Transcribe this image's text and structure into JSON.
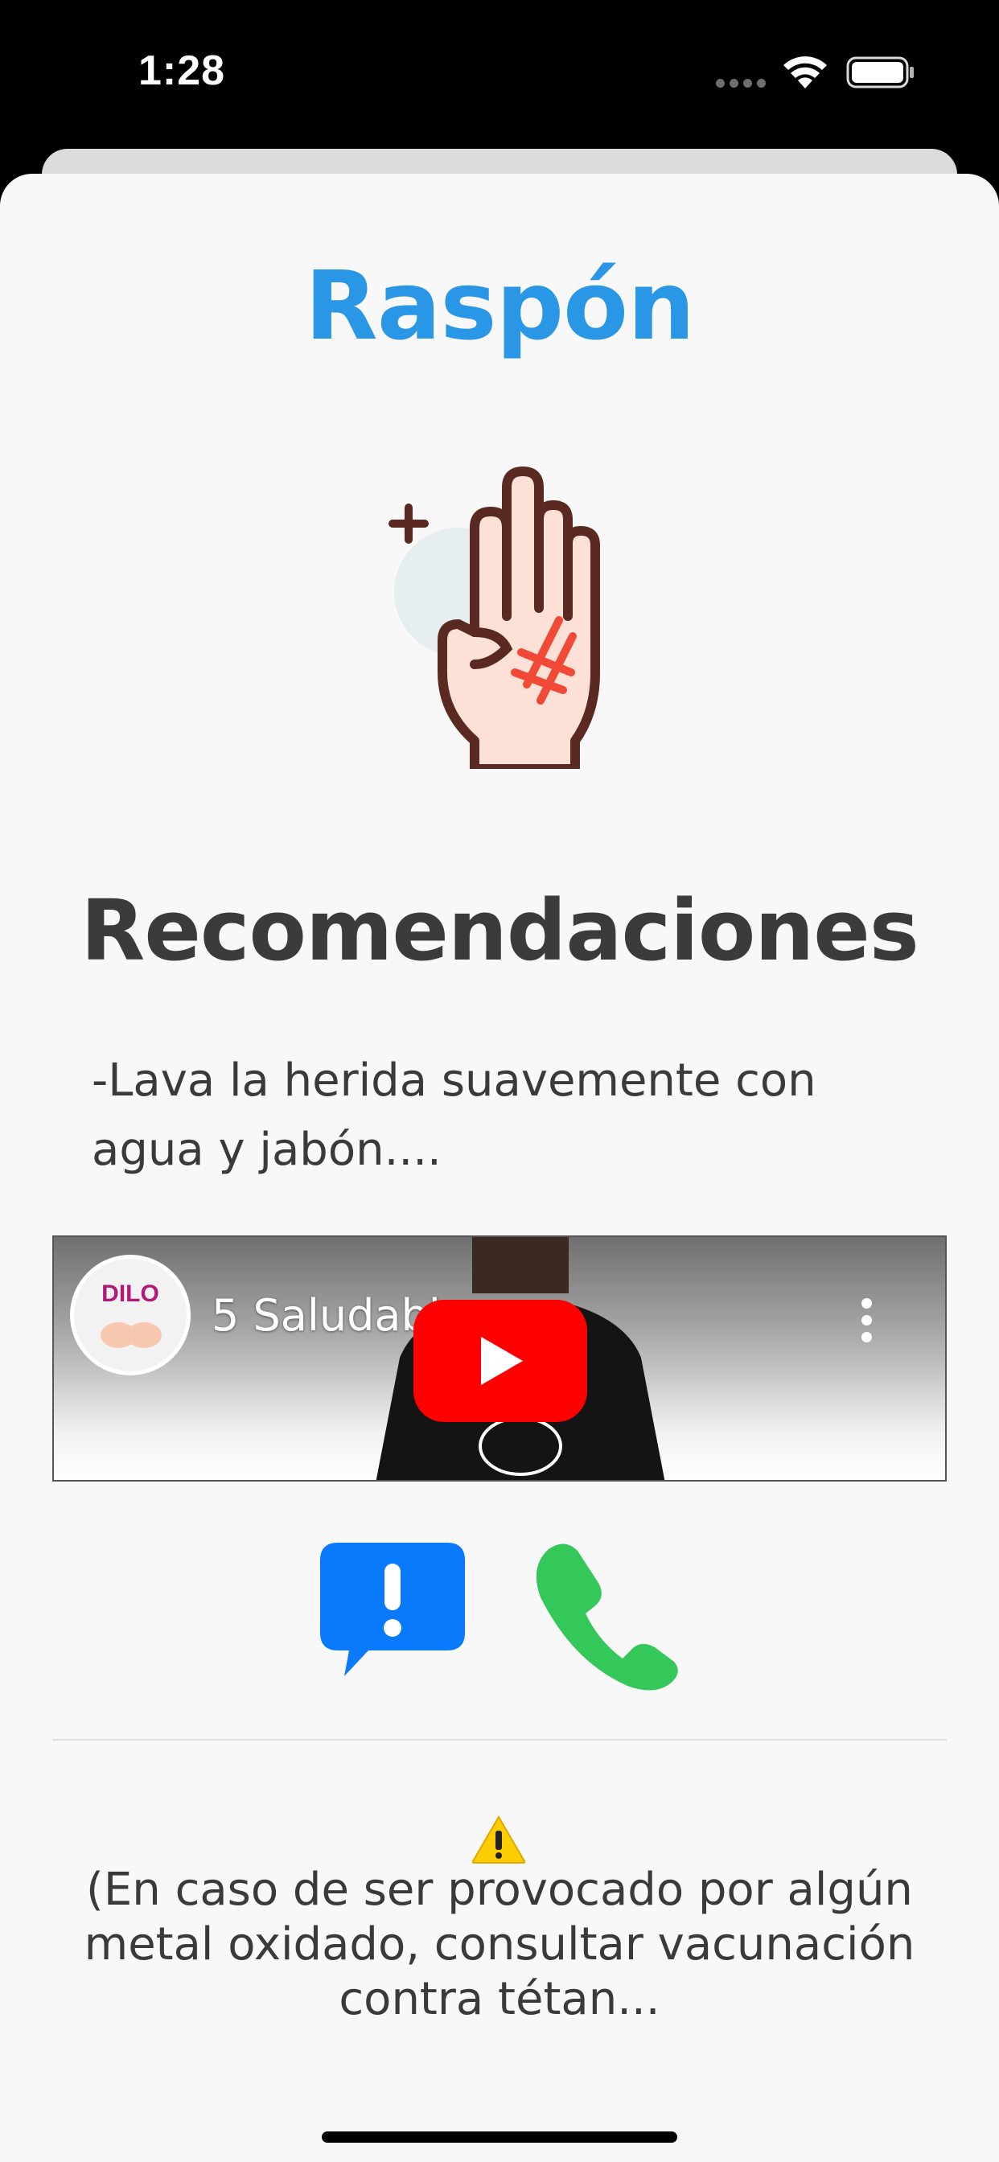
{
  "status_bar": {
    "time": "1:28"
  },
  "screen": {
    "title": "Raspón",
    "hero_icon": "scraped-hand-icon",
    "section_heading": "Recomendaciones",
    "recommendation": "-Lava la herida suavemente con agua y jabón....",
    "video": {
      "title": "5 Saludabl",
      "channel_logo_text": "DILO",
      "play_icon": "youtube-play-icon"
    },
    "actions": {
      "alert_icon": "exclamation-chat-icon",
      "call_icon": "phone-icon"
    },
    "warning": {
      "icon": "warning-icon",
      "text": "(En caso de ser provocado por algún metal oxidado, consultar vacunación contra tétan..."
    }
  },
  "colors": {
    "title_blue": "#2a96e6",
    "alert_blue": "#0a7afc",
    "call_green": "#34c759",
    "youtube_red": "#ff0000",
    "sheet_bg": "#f8f8f8"
  }
}
